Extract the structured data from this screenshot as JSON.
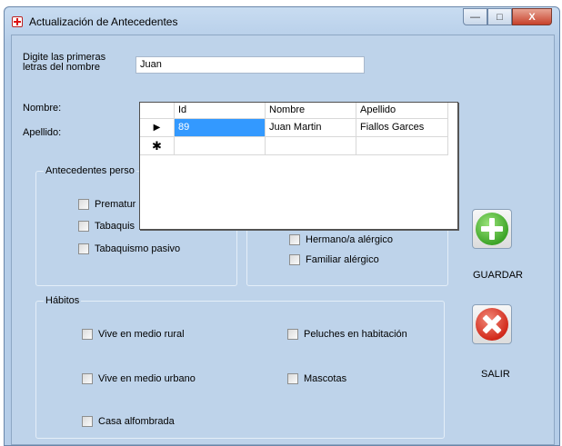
{
  "window": {
    "title": "Actualización de Antecedentes",
    "buttons": {
      "minimize": "—",
      "maximize": "□",
      "close": "X"
    }
  },
  "search": {
    "label": "Digite las primeras letras del nombre",
    "label_line1": "Digite las primeras",
    "label_line2": "letras del nombre",
    "value": "Juan"
  },
  "fields": {
    "nombre_label": "Nombre:",
    "apellido_label": "Apellido:"
  },
  "grid": {
    "columns": [
      "Id",
      "Nombre",
      "Apellido"
    ],
    "rows": [
      {
        "Id": "89",
        "Nombre": "Juan Martin",
        "Apellido": "Fiallos Garces"
      }
    ],
    "current_row_marker": "▶",
    "new_row_marker": "✱"
  },
  "antecedentes": {
    "title": "Antecedentes perso",
    "items": [
      "Prematuro",
      "Tabaquismo",
      "Tabaquismo pasivo"
    ],
    "visible_items": [
      "Prematur",
      "Tabaquis",
      "Tabaquismo pasivo"
    ]
  },
  "familiares": {
    "items": [
      "Hermano/a alérgico",
      "Familiar alérgico"
    ]
  },
  "habitos": {
    "title": "Hábitos",
    "items": [
      "Vive en medio rural",
      "Vive en medio urbano",
      "Casa alfombrada",
      "Peluches en habitación",
      "Mascotas"
    ]
  },
  "actions": {
    "guardar": "GUARDAR",
    "salir": "SALIR"
  },
  "colors": {
    "client_bg": "#bed3ea",
    "selection": "#3399ff",
    "guardar_icon": "#3ea528",
    "salir_icon": "#d22a1b"
  }
}
